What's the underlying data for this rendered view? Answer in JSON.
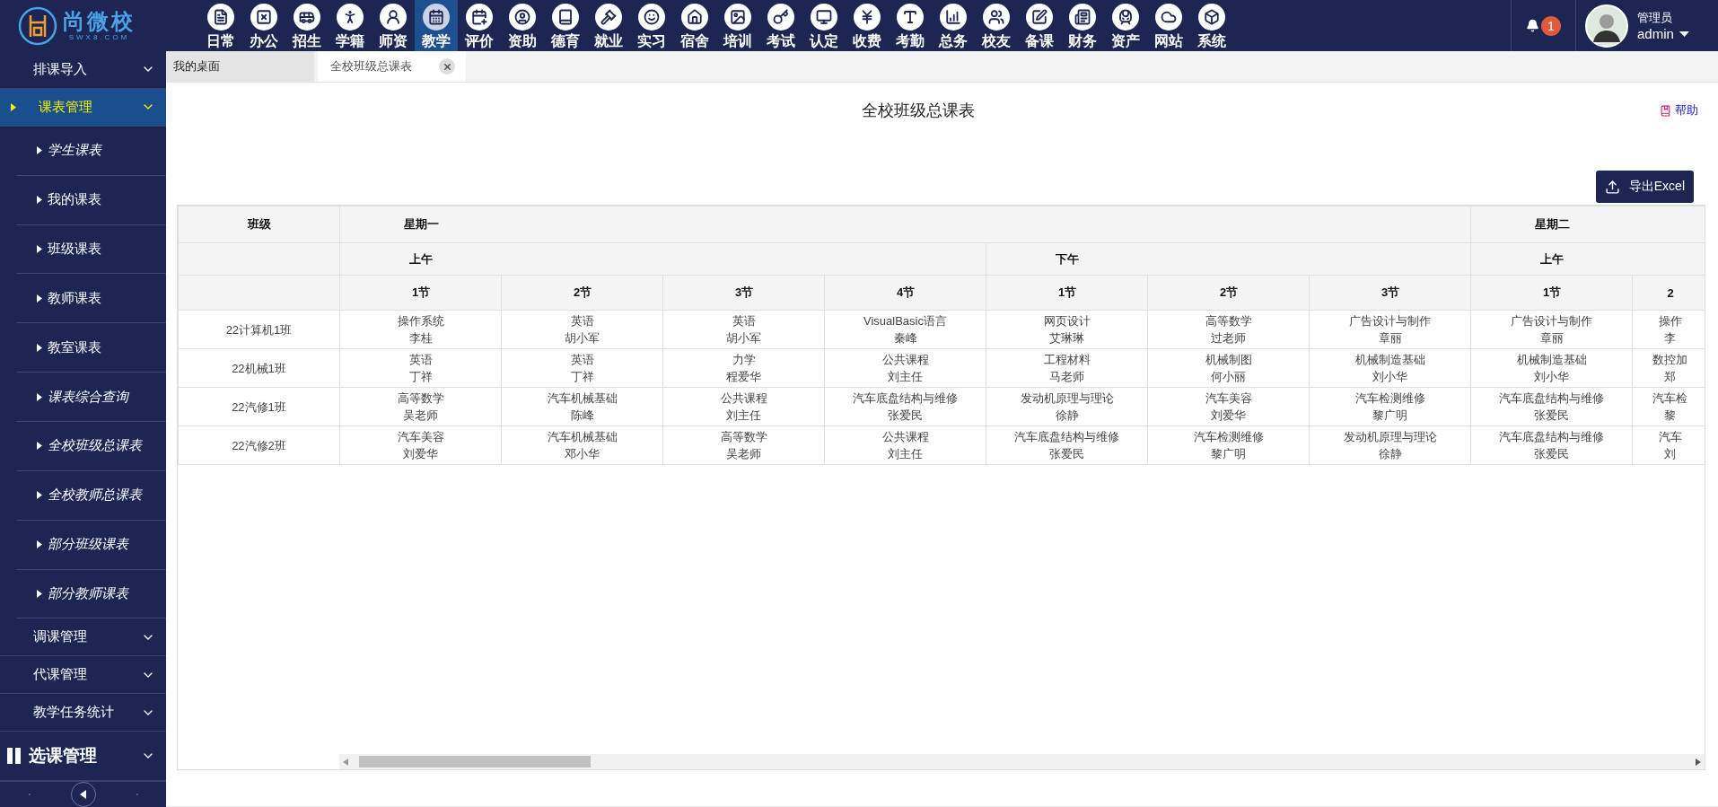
{
  "logo": {
    "name": "尚微校",
    "domain": "SWX8.COM"
  },
  "nav": [
    {
      "label": "日常",
      "selected": false
    },
    {
      "label": "办公",
      "selected": false
    },
    {
      "label": "招生",
      "selected": false
    },
    {
      "label": "学籍",
      "selected": false
    },
    {
      "label": "师资",
      "selected": false
    },
    {
      "label": "教学",
      "selected": true
    },
    {
      "label": "评价",
      "selected": false
    },
    {
      "label": "资助",
      "selected": false
    },
    {
      "label": "德育",
      "selected": false
    },
    {
      "label": "就业",
      "selected": false
    },
    {
      "label": "实习",
      "selected": false
    },
    {
      "label": "宿舍",
      "selected": false
    },
    {
      "label": "培训",
      "selected": false
    },
    {
      "label": "考试",
      "selected": false
    },
    {
      "label": "认定",
      "selected": false
    },
    {
      "label": "收费",
      "selected": false
    },
    {
      "label": "考勤",
      "selected": false
    },
    {
      "label": "总务",
      "selected": false
    },
    {
      "label": "校友",
      "selected": false
    },
    {
      "label": "备课",
      "selected": false
    },
    {
      "label": "财务",
      "selected": false
    },
    {
      "label": "资产",
      "selected": false
    },
    {
      "label": "网站",
      "selected": false
    },
    {
      "label": "系统",
      "selected": false
    }
  ],
  "user": {
    "notifications": "1",
    "role": "管理员",
    "name": "admin"
  },
  "sidebar": {
    "items": [
      {
        "kind": "group",
        "label": "排课导入",
        "selected": false
      },
      {
        "kind": "group",
        "label": "课表管理",
        "selected": true,
        "expanded": true,
        "children": [
          {
            "label": "学生课表",
            "italic": true
          },
          {
            "label": "我的课表",
            "italic": false
          },
          {
            "label": "班级课表",
            "italic": false
          },
          {
            "label": "教师课表",
            "italic": false
          },
          {
            "label": "教室课表",
            "italic": false
          },
          {
            "label": "课表综合查询",
            "italic": true
          },
          {
            "label": "全校班级总课表",
            "italic": true
          },
          {
            "label": "全校教师总课表",
            "italic": true
          },
          {
            "label": "部分班级课表",
            "italic": true
          },
          {
            "label": "部分教师课表",
            "italic": true
          }
        ]
      },
      {
        "kind": "group",
        "label": "调课管理",
        "selected": false
      },
      {
        "kind": "group",
        "label": "代课管理",
        "selected": false
      },
      {
        "kind": "group",
        "label": "教学任务统计",
        "selected": false
      },
      {
        "kind": "section",
        "label": "选课管理",
        "selected": false
      }
    ]
  },
  "tabs": [
    {
      "label": "我的桌面",
      "selected": false,
      "closable": false
    },
    {
      "label": "全校班级总课表",
      "selected": true,
      "closable": true
    }
  ],
  "page": {
    "title": "全校班级总课表",
    "help": "帮助",
    "export_button": "导出Excel"
  },
  "table": {
    "class_header": "班级",
    "days": [
      {
        "label": "星期一",
        "periods": [
          {
            "label": "上午",
            "slots": [
              "1节",
              "2节",
              "3节",
              "4节"
            ]
          },
          {
            "label": "下午",
            "slots": [
              "1节",
              "2节",
              "3节"
            ]
          }
        ]
      },
      {
        "label": "星期二",
        "periods": [
          {
            "label": "上午",
            "slots": [
              "1节",
              "2"
            ]
          }
        ]
      }
    ],
    "rows": [
      {
        "class": "22计算机1班",
        "cells": [
          {
            "course": "操作系统",
            "teacher": "李桂"
          },
          {
            "course": "英语",
            "teacher": "胡小军"
          },
          {
            "course": "英语",
            "teacher": "胡小军"
          },
          {
            "course": "VisualBasic语言",
            "teacher": "秦峰"
          },
          {
            "course": "网页设计",
            "teacher": "艾琳琳"
          },
          {
            "course": "高等数学",
            "teacher": "过老师"
          },
          {
            "course": "广告设计与制作",
            "teacher": "章丽"
          },
          {
            "course": "广告设计与制作",
            "teacher": "章丽"
          },
          {
            "course": "操作",
            "teacher": "李"
          }
        ]
      },
      {
        "class": "22机械1班",
        "cells": [
          {
            "course": "英语",
            "teacher": "丁祥"
          },
          {
            "course": "英语",
            "teacher": "丁祥"
          },
          {
            "course": "力学",
            "teacher": "程爱华"
          },
          {
            "course": "公共课程",
            "teacher": "刘主任"
          },
          {
            "course": "工程材料",
            "teacher": "马老师"
          },
          {
            "course": "机械制图",
            "teacher": "何小丽"
          },
          {
            "course": "机械制造基础",
            "teacher": "刘小华"
          },
          {
            "course": "机械制造基础",
            "teacher": "刘小华"
          },
          {
            "course": "数控加",
            "teacher": "郑"
          }
        ]
      },
      {
        "class": "22汽修1班",
        "cells": [
          {
            "course": "高等数学",
            "teacher": "吴老师"
          },
          {
            "course": "汽车机械基础",
            "teacher": "陈峰"
          },
          {
            "course": "公共课程",
            "teacher": "刘主任"
          },
          {
            "course": "汽车底盘结构与维修",
            "teacher": "张爱民"
          },
          {
            "course": "发动机原理与理论",
            "teacher": "徐静"
          },
          {
            "course": "汽车美容",
            "teacher": "刘爱华"
          },
          {
            "course": "汽车检测维修",
            "teacher": "黎广明"
          },
          {
            "course": "汽车底盘结构与维修",
            "teacher": "张爱民"
          },
          {
            "course": "汽车检",
            "teacher": "黎"
          }
        ]
      },
      {
        "class": "22汽修2班",
        "cells": [
          {
            "course": "汽车美容",
            "teacher": "刘爱华"
          },
          {
            "course": "汽车机械基础",
            "teacher": "邓小华"
          },
          {
            "course": "高等数学",
            "teacher": "吴老师"
          },
          {
            "course": "公共课程",
            "teacher": "刘主任"
          },
          {
            "course": "汽车底盘结构与维修",
            "teacher": "张爱民"
          },
          {
            "course": "汽车检测维修",
            "teacher": "黎广明"
          },
          {
            "course": "发动机原理与理论",
            "teacher": "徐静"
          },
          {
            "course": "汽车底盘结构与维修",
            "teacher": "张爱民"
          },
          {
            "course": "汽车",
            "teacher": "刘"
          }
        ]
      }
    ]
  }
}
